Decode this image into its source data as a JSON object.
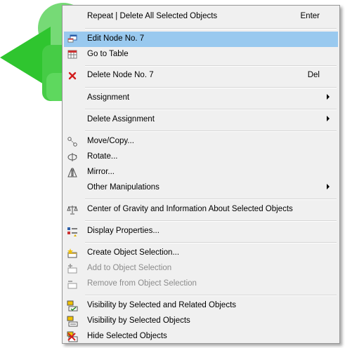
{
  "menu": {
    "items": {
      "repeat": {
        "label": "Repeat | Delete All Selected Objects",
        "shortcut": "Enter",
        "icon": "none"
      },
      "edit_node": {
        "label": "Edit Node No. 7",
        "icon": "edit-window-icon",
        "highlighted": true
      },
      "go_to_table": {
        "label": "Go to Table",
        "icon": "table-icon"
      },
      "delete_node": {
        "label": "Delete Node No. 7",
        "shortcut": "Del",
        "icon": "red-x-icon"
      },
      "assignment": {
        "label": "Assignment",
        "submenu": true
      },
      "delete_assignment": {
        "label": "Delete Assignment",
        "submenu": true
      },
      "move_copy": {
        "label": "Move/Copy...",
        "icon": "move-copy-icon"
      },
      "rotate": {
        "label": "Rotate...",
        "icon": "rotate-icon"
      },
      "mirror": {
        "label": "Mirror...",
        "icon": "mirror-icon"
      },
      "other_manipulations": {
        "label": "Other Manipulations",
        "submenu": true
      },
      "center_of_gravity": {
        "label": "Center of Gravity and Information About Selected Objects",
        "icon": "balance-scale-icon"
      },
      "display_properties": {
        "label": "Display Properties...",
        "icon": "display-properties-icon"
      },
      "create_selection": {
        "label": "Create Object Selection...",
        "icon": "create-selection-icon"
      },
      "add_to_selection": {
        "label": "Add to Object Selection",
        "icon": "add-selection-icon",
        "disabled": true
      },
      "remove_from_selection": {
        "label": "Remove from Object Selection",
        "icon": "remove-selection-icon",
        "disabled": true
      },
      "visibility_related": {
        "label": "Visibility by Selected and Related Objects",
        "icon": "visibility-related-icon"
      },
      "visibility_selected": {
        "label": "Visibility by Selected Objects",
        "icon": "visibility-selected-icon"
      },
      "hide_selected": {
        "label": "Hide Selected Objects",
        "icon": "hide-selected-icon"
      }
    }
  },
  "colors": {
    "highlight": "#99c9ef",
    "menu_background": "#f0f0f0",
    "disabled_text": "#8c8c8c",
    "background_green": "#2fc52f"
  }
}
